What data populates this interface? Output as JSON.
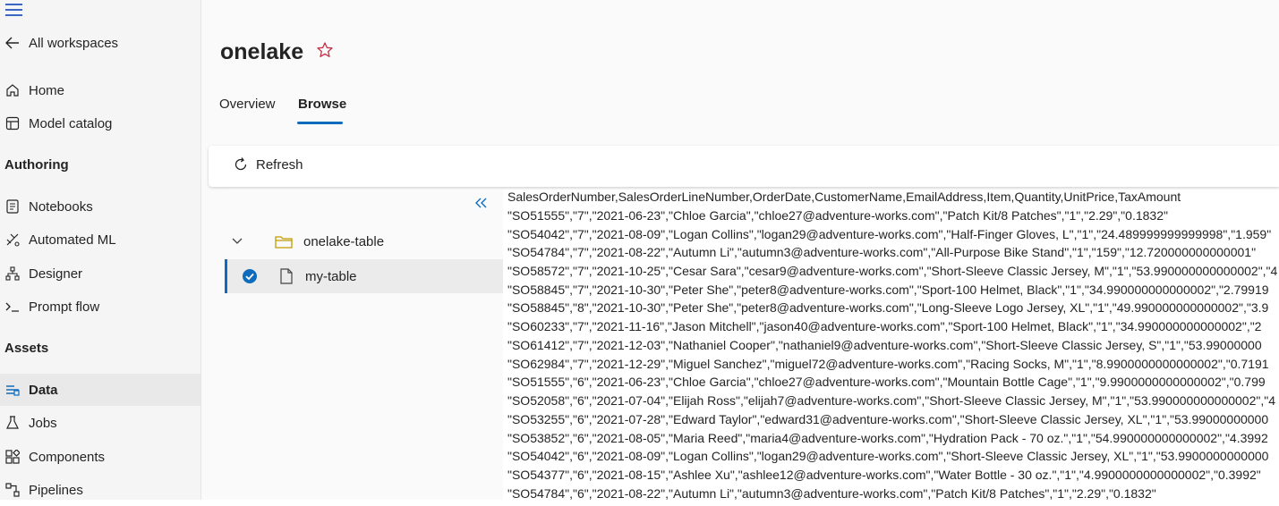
{
  "sidebar": {
    "back_label": "All workspaces",
    "items_top": [
      {
        "label": "Home",
        "icon": "home-icon"
      },
      {
        "label": "Model catalog",
        "icon": "catalog-icon"
      }
    ],
    "authoring_heading": "Authoring",
    "authoring_items": [
      {
        "label": "Notebooks",
        "icon": "notebook-icon"
      },
      {
        "label": "Automated ML",
        "icon": "automl-icon"
      },
      {
        "label": "Designer",
        "icon": "designer-icon"
      },
      {
        "label": "Prompt flow",
        "icon": "prompt-icon"
      }
    ],
    "assets_heading": "Assets",
    "assets_items": [
      {
        "label": "Data",
        "icon": "data-icon",
        "active": true
      },
      {
        "label": "Jobs",
        "icon": "flask-icon"
      },
      {
        "label": "Components",
        "icon": "components-icon"
      },
      {
        "label": "Pipelines",
        "icon": "pipelines-icon"
      }
    ]
  },
  "page": {
    "title": "onelake",
    "tabs": [
      "Overview",
      "Browse"
    ],
    "active_tab": "Browse"
  },
  "toolbar": {
    "refresh_label": "Refresh"
  },
  "tree": {
    "folder": "onelake-table",
    "file": "my-table"
  },
  "preview": {
    "lines": [
      "SalesOrderNumber,SalesOrderLineNumber,OrderDate,CustomerName,EmailAddress,Item,Quantity,UnitPrice,TaxAmount",
      "\"SO51555\",\"7\",\"2021-06-23\",\"Chloe Garcia\",\"chloe27@adventure-works.com\",\"Patch Kit/8 Patches\",\"1\",\"2.29\",\"0.1832\"",
      "\"SO54042\",\"7\",\"2021-08-09\",\"Logan Collins\",\"logan29@adventure-works.com\",\"Half-Finger Gloves, L\",\"1\",\"24.489999999999998\",\"1.959\"",
      "\"SO54784\",\"7\",\"2021-08-22\",\"Autumn Li\",\"autumn3@adventure-works.com\",\"All-Purpose Bike Stand\",\"1\",\"159\",\"12.720000000000001\"",
      "\"SO58572\",\"7\",\"2021-10-25\",\"Cesar Sara\",\"cesar9@adventure-works.com\",\"Short-Sleeve Classic Jersey, M\",\"1\",\"53.990000000000002\",\"4",
      "\"SO58845\",\"7\",\"2021-10-30\",\"Peter She\",\"peter8@adventure-works.com\",\"Sport-100 Helmet, Black\",\"1\",\"34.990000000000002\",\"2.79919",
      "\"SO58845\",\"8\",\"2021-10-30\",\"Peter She\",\"peter8@adventure-works.com\",\"Long-Sleeve Logo Jersey, XL\",\"1\",\"49.990000000000002\",\"3.9",
      "\"SO60233\",\"7\",\"2021-11-16\",\"Jason Mitchell\",\"jason40@adventure-works.com\",\"Sport-100 Helmet, Black\",\"1\",\"34.990000000000002\",\"2",
      "\"SO61412\",\"7\",\"2021-12-03\",\"Nathaniel Cooper\",\"nathaniel9@adventure-works.com\",\"Short-Sleeve Classic Jersey, S\",\"1\",\"53.99000000",
      "\"SO62984\",\"7\",\"2021-12-29\",\"Miguel Sanchez\",\"miguel72@adventure-works.com\",\"Racing Socks, M\",\"1\",\"8.9900000000000002\",\"0.7191",
      "\"SO51555\",\"6\",\"2021-06-23\",\"Chloe Garcia\",\"chloe27@adventure-works.com\",\"Mountain Bottle Cage\",\"1\",\"9.9900000000000002\",\"0.799",
      "\"SO52058\",\"6\",\"2021-07-04\",\"Elijah Ross\",\"elijah7@adventure-works.com\",\"Short-Sleeve Classic Jersey, M\",\"1\",\"53.990000000000002\",\"4",
      "\"SO53255\",\"6\",\"2021-07-28\",\"Edward Taylor\",\"edward31@adventure-works.com\",\"Short-Sleeve Classic Jersey, XL\",\"1\",\"53.99000000000",
      "\"SO53852\",\"6\",\"2021-08-05\",\"Maria Reed\",\"maria4@adventure-works.com\",\"Hydration Pack - 70 oz.\",\"1\",\"54.990000000000002\",\"4.3992",
      "\"SO54042\",\"6\",\"2021-08-09\",\"Logan Collins\",\"logan29@adventure-works.com\",\"Short-Sleeve Classic Jersey, XL\",\"1\",\"53.9900000000000",
      "\"SO54377\",\"6\",\"2021-08-15\",\"Ashlee Xu\",\"ashlee12@adventure-works.com\",\"Water Bottle - 30 oz.\",\"1\",\"4.9900000000000002\",\"0.3992\"",
      "\"SO54784\",\"6\",\"2021-08-22\",\"Autumn Li\",\"autumn3@adventure-works.com\",\"Patch Kit/8 Patches\",\"1\",\"2.29\",\"0.1832\""
    ]
  },
  "colors": {
    "accent": "#0f6cbd",
    "star": "#c4314b"
  }
}
